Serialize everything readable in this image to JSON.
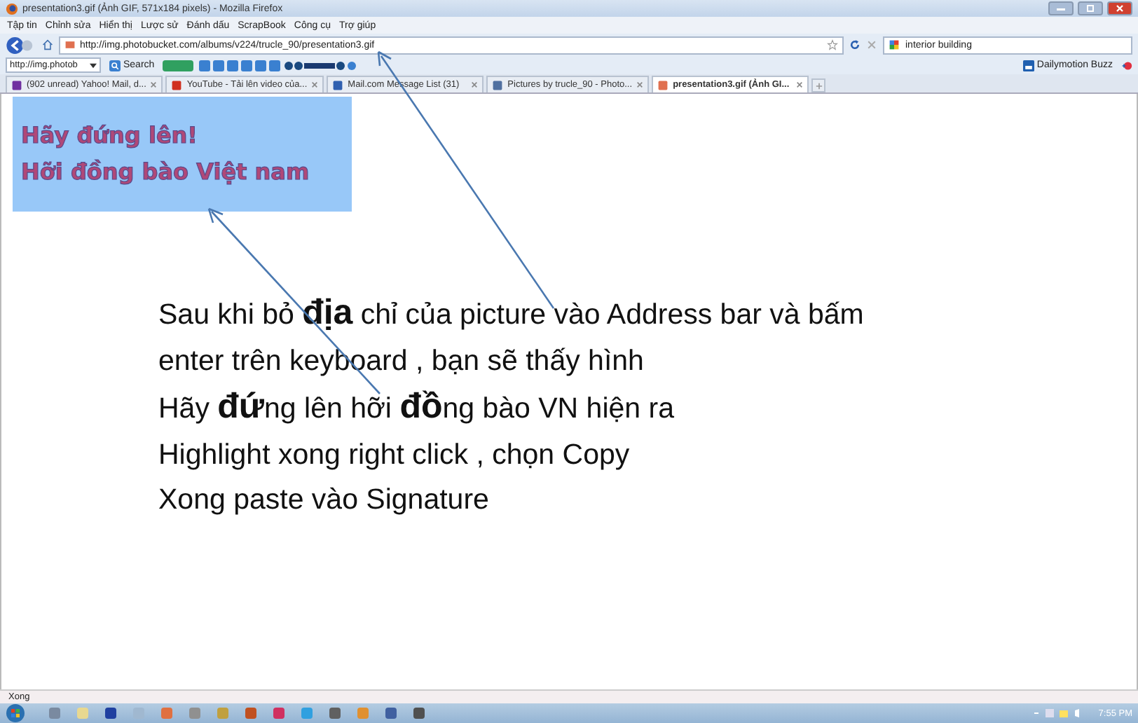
{
  "window": {
    "title": "presentation3.gif (Ảnh GIF, 571x184 pixels) - Mozilla Firefox"
  },
  "menu": [
    "Tập tin",
    "Chỉnh sửa",
    "Hiển thị",
    "Lược sử",
    "Đánh dấu",
    "ScrapBook",
    "Công cụ",
    "Trợ giúp"
  ],
  "navigation": {
    "url": "http://img.photobucket.com/albums/v224/trucle_90/presentation3.gif",
    "search": "interior building"
  },
  "toolbar": {
    "address": "http://img.photob",
    "search_button": "Search",
    "bookmark": "Dailymotion Buzz"
  },
  "tabs": [
    {
      "label": "(902 unread) Yahoo! Mail, d...",
      "selected": false
    },
    {
      "label": "YouTube - Tải lên video của...",
      "selected": false
    },
    {
      "label": "Mail.com Message List (31)",
      "selected": false
    },
    {
      "label": "Pictures by trucle_90 - Photo...",
      "selected": false
    },
    {
      "label": "presentation3.gif (Ảnh GI...",
      "selected": true
    }
  ],
  "image": {
    "lines": [
      "Hãy đứng lên!",
      "Hỡi đồng bào Việt nam"
    ]
  },
  "annotation": [
    "Sau khi bỏ **địa** chỉ của picture vào Address bar và bấm",
    "enter trên keyboard , bạn sẽ thấy hình",
    "Hãy **đứ**ng lên hỡi **đồ**ng bào VN hiện ra",
    "Highlight  xong right click , chọn Copy",
    "Xong paste vào Signature"
  ],
  "status_bar": {
    "text": "Xong"
  },
  "taskbar": {
    "clock": "7:55 PM"
  }
}
